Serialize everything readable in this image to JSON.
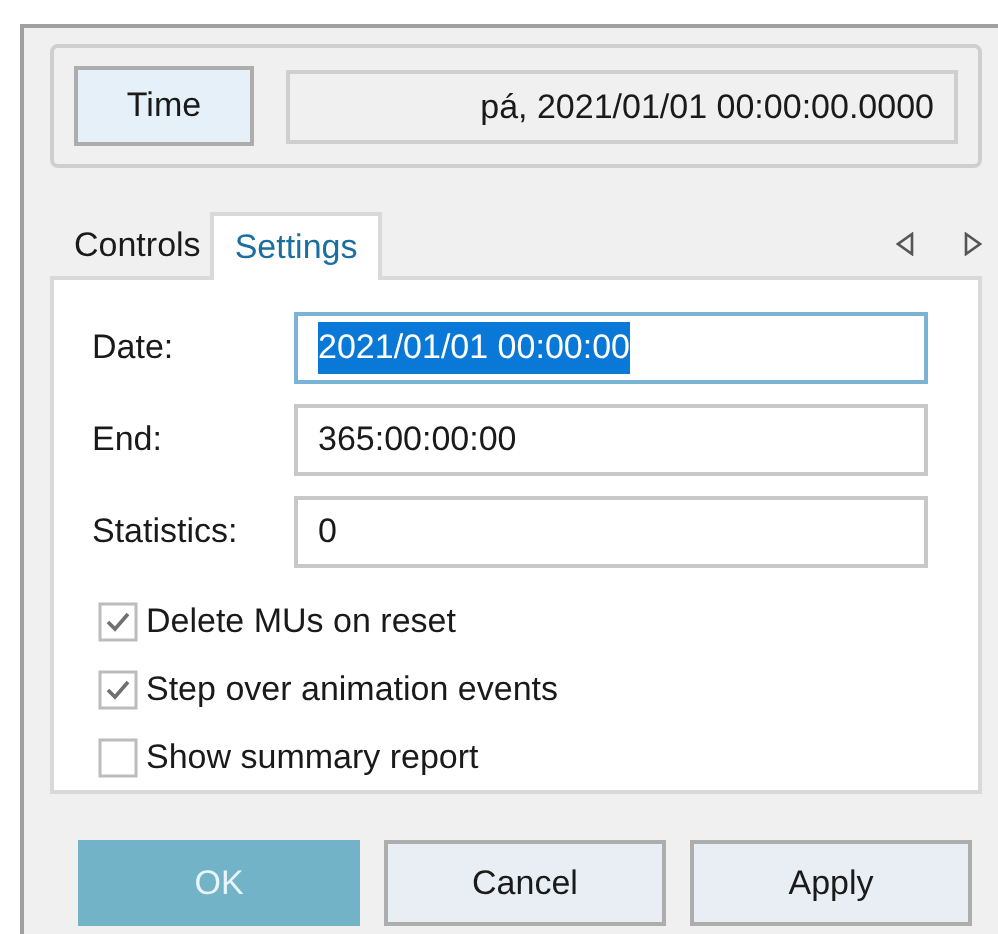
{
  "time": {
    "button": "Time",
    "value": "pá, 2021/01/01 00:00:00.0000"
  },
  "tabs": [
    {
      "label": "Controls",
      "selected": false
    },
    {
      "label": "Settings",
      "selected": true
    }
  ],
  "fields": [
    {
      "label": "Date:",
      "value": "2021/01/01 00:00:00",
      "focused": true
    },
    {
      "label": "End:",
      "value": "365:00:00:00",
      "focused": false
    },
    {
      "label": "Statistics:",
      "value": "0",
      "focused": false
    }
  ],
  "checkboxes": [
    {
      "label": "Delete MUs on reset",
      "checked": true
    },
    {
      "label": "Step over animation events",
      "checked": true
    },
    {
      "label": "Show summary report",
      "checked": false
    }
  ],
  "buttons": [
    {
      "label": "OK",
      "default": true
    },
    {
      "label": "Cancel",
      "default": false
    },
    {
      "label": "Apply",
      "default": false
    }
  ]
}
